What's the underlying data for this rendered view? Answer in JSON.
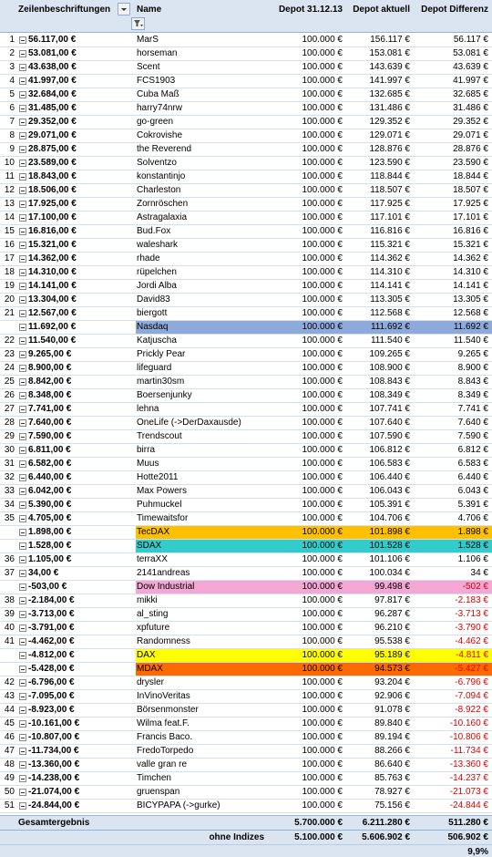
{
  "header": {
    "row_labels": "Zeilenbeschriftungen",
    "name": "Name",
    "col1": "Depot 31.12.13",
    "col2": "Depot aktuell",
    "col3": "Depot Differenz"
  },
  "colors": {
    "header_bg": "#dbe5f1",
    "negative": "#e00000",
    "Nasdaq": "#8eaadb",
    "TecDAX": "#ffc000",
    "SDAX": "#33cccc",
    "Dow Industrial": "#f4a6d4",
    "DAX": "#ffff00",
    "MDAX": "#ff6a00"
  },
  "rows": [
    {
      "idx": "1",
      "label": "56.117,00 €",
      "name": "MarS",
      "c1": "100.000 €",
      "c2": "156.117 €",
      "c3": "56.117 €"
    },
    {
      "idx": "2",
      "label": "53.081,00 €",
      "name": "horseman",
      "c1": "100.000 €",
      "c2": "153.081 €",
      "c3": "53.081 €"
    },
    {
      "idx": "3",
      "label": "43.638,00 €",
      "name": "Scent",
      "c1": "100.000 €",
      "c2": "143.639 €",
      "c3": "43.639 €"
    },
    {
      "idx": "4",
      "label": "41.997,00 €",
      "name": "FCS1903",
      "c1": "100.000 €",
      "c2": "141.997 €",
      "c3": "41.997 €"
    },
    {
      "idx": "5",
      "label": "32.684,00 €",
      "name": "Cuba Maß",
      "c1": "100.000 €",
      "c2": "132.685 €",
      "c3": "32.685 €"
    },
    {
      "idx": "6",
      "label": "31.485,00 €",
      "name": "harry74nrw",
      "c1": "100.000 €",
      "c2": "131.486 €",
      "c3": "31.486 €"
    },
    {
      "idx": "7",
      "label": "29.352,00 €",
      "name": "go-green",
      "c1": "100.000 €",
      "c2": "129.352 €",
      "c3": "29.352 €"
    },
    {
      "idx": "8",
      "label": "29.071,00 €",
      "name": "Cokrovishe",
      "c1": "100.000 €",
      "c2": "129.071 €",
      "c3": "29.071 €"
    },
    {
      "idx": "9",
      "label": "28.875,00 €",
      "name": "the Reverend",
      "c1": "100.000 €",
      "c2": "128.876 €",
      "c3": "28.876 €"
    },
    {
      "idx": "10",
      "label": "23.589,00 €",
      "name": "Solventzo",
      "c1": "100.000 €",
      "c2": "123.590 €",
      "c3": "23.590 €"
    },
    {
      "idx": "11",
      "label": "18.843,00 €",
      "name": "konstantinjo",
      "c1": "100.000 €",
      "c2": "118.844 €",
      "c3": "18.844 €"
    },
    {
      "idx": "12",
      "label": "18.506,00 €",
      "name": "Charleston",
      "c1": "100.000 €",
      "c2": "118.507 €",
      "c3": "18.507 €"
    },
    {
      "idx": "13",
      "label": "17.925,00 €",
      "name": "Zornröschen",
      "c1": "100.000 €",
      "c2": "117.925 €",
      "c3": "17.925 €"
    },
    {
      "idx": "14",
      "label": "17.100,00 €",
      "name": "Astragalaxia",
      "c1": "100.000 €",
      "c2": "117.101 €",
      "c3": "17.101 €"
    },
    {
      "idx": "15",
      "label": "16.816,00 €",
      "name": "Bud.Fox",
      "c1": "100.000 €",
      "c2": "116.816 €",
      "c3": "16.816 €"
    },
    {
      "idx": "16",
      "label": "15.321,00 €",
      "name": "waleshark",
      "c1": "100.000 €",
      "c2": "115.321 €",
      "c3": "15.321 €"
    },
    {
      "idx": "17",
      "label": "14.362,00 €",
      "name": "rhade",
      "c1": "100.000 €",
      "c2": "114.362 €",
      "c3": "14.362 €"
    },
    {
      "idx": "18",
      "label": "14.310,00 €",
      "name": "rüpelchen",
      "c1": "100.000 €",
      "c2": "114.310 €",
      "c3": "14.310 €"
    },
    {
      "idx": "19",
      "label": "14.141,00 €",
      "name": "Jordi Alba",
      "c1": "100.000 €",
      "c2": "114.141 €",
      "c3": "14.141 €"
    },
    {
      "idx": "20",
      "label": "13.304,00 €",
      "name": "David83",
      "c1": "100.000 €",
      "c2": "113.305 €",
      "c3": "13.305 €"
    },
    {
      "idx": "21",
      "label": "12.567,00 €",
      "name": "biergott",
      "c1": "100.000 €",
      "c2": "112.568 €",
      "c3": "12.568 €"
    },
    {
      "idx": "",
      "label": "11.692,00 €",
      "name": "Nasdaq",
      "c1": "100.000 €",
      "c2": "111.692 €",
      "c3": "11.692 €",
      "hl": "Nasdaq"
    },
    {
      "idx": "22",
      "label": "11.540,00 €",
      "name": "Katjuscha",
      "c1": "100.000 €",
      "c2": "111.540 €",
      "c3": "11.540 €"
    },
    {
      "idx": "23",
      "label": "9.265,00 €",
      "name": "Prickly Pear",
      "c1": "100.000 €",
      "c2": "109.265 €",
      "c3": "9.265 €"
    },
    {
      "idx": "24",
      "label": "8.900,00 €",
      "name": "lifeguard",
      "c1": "100.000 €",
      "c2": "108.900 €",
      "c3": "8.900 €"
    },
    {
      "idx": "25",
      "label": "8.842,00 €",
      "name": "martin30sm",
      "c1": "100.000 €",
      "c2": "108.843 €",
      "c3": "8.843 €"
    },
    {
      "idx": "26",
      "label": "8.348,00 €",
      "name": "Boersenjunky",
      "c1": "100.000 €",
      "c2": "108.349 €",
      "c3": "8.349 €"
    },
    {
      "idx": "27",
      "label": "7.741,00 €",
      "name": "lehna",
      "c1": "100.000 €",
      "c2": "107.741 €",
      "c3": "7.741 €"
    },
    {
      "idx": "28",
      "label": "7.640,00 €",
      "name": "OneLife (->DerDaxausde)",
      "c1": "100.000 €",
      "c2": "107.640 €",
      "c3": "7.640 €"
    },
    {
      "idx": "29",
      "label": "7.590,00 €",
      "name": "Trendscout",
      "c1": "100.000 €",
      "c2": "107.590 €",
      "c3": "7.590 €"
    },
    {
      "idx": "30",
      "label": "6.811,00 €",
      "name": "birra",
      "c1": "100.000 €",
      "c2": "106.812 €",
      "c3": "6.812 €"
    },
    {
      "idx": "31",
      "label": "6.582,00 €",
      "name": "Muus",
      "c1": "100.000 €",
      "c2": "106.583 €",
      "c3": "6.583 €"
    },
    {
      "idx": "32",
      "label": "6.440,00 €",
      "name": "Hotte2011",
      "c1": "100.000 €",
      "c2": "106.440 €",
      "c3": "6.440 €"
    },
    {
      "idx": "33",
      "label": "6.042,00 €",
      "name": "Max Powers",
      "c1": "100.000 €",
      "c2": "106.043 €",
      "c3": "6.043 €"
    },
    {
      "idx": "34",
      "label": "5.390,00 €",
      "name": "Puhmuckel",
      "c1": "100.000 €",
      "c2": "105.391 €",
      "c3": "5.391 €"
    },
    {
      "idx": "35",
      "label": "4.705,00 €",
      "name": "Timewaitsfor",
      "c1": "100.000 €",
      "c2": "104.706 €",
      "c3": "4.706 €"
    },
    {
      "idx": "",
      "label": "1.898,00 €",
      "name": "TecDAX",
      "c1": "100.000 €",
      "c2": "101.898 €",
      "c3": "1.898 €",
      "hl": "TecDAX"
    },
    {
      "idx": "",
      "label": "1.528,00 €",
      "name": "SDAX",
      "c1": "100.000 €",
      "c2": "101.528 €",
      "c3": "1.528 €",
      "hl": "SDAX"
    },
    {
      "idx": "36",
      "label": "1.105,00 €",
      "name": "terraXX",
      "c1": "100.000 €",
      "c2": "101.106 €",
      "c3": "1.106 €"
    },
    {
      "idx": "37",
      "label": "34,00 €",
      "name": "2141andreas",
      "c1": "100.000 €",
      "c2": "100.034 €",
      "c3": "34 €"
    },
    {
      "idx": "",
      "label": "-503,00 €",
      "name": "Dow Industrial",
      "c1": "100.000 €",
      "c2": "99.498 €",
      "c3": "-502 €",
      "hl": "Dow Industrial",
      "neg": true
    },
    {
      "idx": "38",
      "label": "-2.184,00 €",
      "name": "mikki",
      "c1": "100.000 €",
      "c2": "97.817 €",
      "c3": "-2.183 €",
      "neg": true
    },
    {
      "idx": "39",
      "label": "-3.713,00 €",
      "name": "al_sting",
      "c1": "100.000 €",
      "c2": "96.287 €",
      "c3": "-3.713 €",
      "neg": true
    },
    {
      "idx": "40",
      "label": "-3.791,00 €",
      "name": "xpfuture",
      "c1": "100.000 €",
      "c2": "96.210 €",
      "c3": "-3.790 €",
      "neg": true
    },
    {
      "idx": "41",
      "label": "-4.462,00 €",
      "name": "Randomness",
      "c1": "100.000 €",
      "c2": "95.538 €",
      "c3": "-4.462 €",
      "neg": true
    },
    {
      "idx": "",
      "label": "-4.812,00 €",
      "name": "DAX",
      "c1": "100.000 €",
      "c2": "95.189 €",
      "c3": "-4.811 €",
      "hl": "DAX",
      "neg": true
    },
    {
      "idx": "",
      "label": "-5.428,00 €",
      "name": "MDAX",
      "c1": "100.000 €",
      "c2": "94.573 €",
      "c3": "-5.427 €",
      "hl": "MDAX",
      "neg": true
    },
    {
      "idx": "42",
      "label": "-6.796,00 €",
      "name": "drysler",
      "c1": "100.000 €",
      "c2": "93.204 €",
      "c3": "-6.796 €",
      "neg": true
    },
    {
      "idx": "43",
      "label": "-7.095,00 €",
      "name": "InVinoVeritas",
      "c1": "100.000 €",
      "c2": "92.906 €",
      "c3": "-7.094 €",
      "neg": true
    },
    {
      "idx": "44",
      "label": "-8.923,00 €",
      "name": "Börsenmonster",
      "c1": "100.000 €",
      "c2": "91.078 €",
      "c3": "-8.922 €",
      "neg": true
    },
    {
      "idx": "45",
      "label": "-10.161,00 €",
      "name": "Wilma feat.F.",
      "c1": "100.000 €",
      "c2": "89.840 €",
      "c3": "-10.160 €",
      "neg": true
    },
    {
      "idx": "46",
      "label": "-10.807,00 €",
      "name": "Francis Baco.",
      "c1": "100.000 €",
      "c2": "89.194 €",
      "c3": "-10.806 €",
      "neg": true
    },
    {
      "idx": "47",
      "label": "-11.734,00 €",
      "name": "FredoTorpedo",
      "c1": "100.000 €",
      "c2": "88.266 €",
      "c3": "-11.734 €",
      "neg": true
    },
    {
      "idx": "48",
      "label": "-13.360,00 €",
      "name": "valle gran re",
      "c1": "100.000 €",
      "c2": "86.640 €",
      "c3": "-13.360 €",
      "neg": true
    },
    {
      "idx": "49",
      "label": "-14.238,00 €",
      "name": "Timchen",
      "c1": "100.000 €",
      "c2": "85.763 €",
      "c3": "-14.237 €",
      "neg": true
    },
    {
      "idx": "50",
      "label": "-21.074,00 €",
      "name": "gruenspan",
      "c1": "100.000 €",
      "c2": "78.927 €",
      "c3": "-21.073 €",
      "neg": true
    },
    {
      "idx": "51",
      "label": "-24.844,00 €",
      "name": "BICYPAPA (->gurke)",
      "c1": "100.000 €",
      "c2": "75.156 €",
      "c3": "-24.844 €",
      "neg": true
    }
  ],
  "totals": {
    "label": "Gesamtergebnis",
    "c1": "5.700.000 €",
    "c2": "6.211.280 €",
    "c3": "511.280 €",
    "sub_label": "ohne Indizes",
    "sub_c1": "5.100.000 €",
    "sub_c2": "5.606.902 €",
    "sub_c3": "506.902 €",
    "percent": "9,9%"
  }
}
